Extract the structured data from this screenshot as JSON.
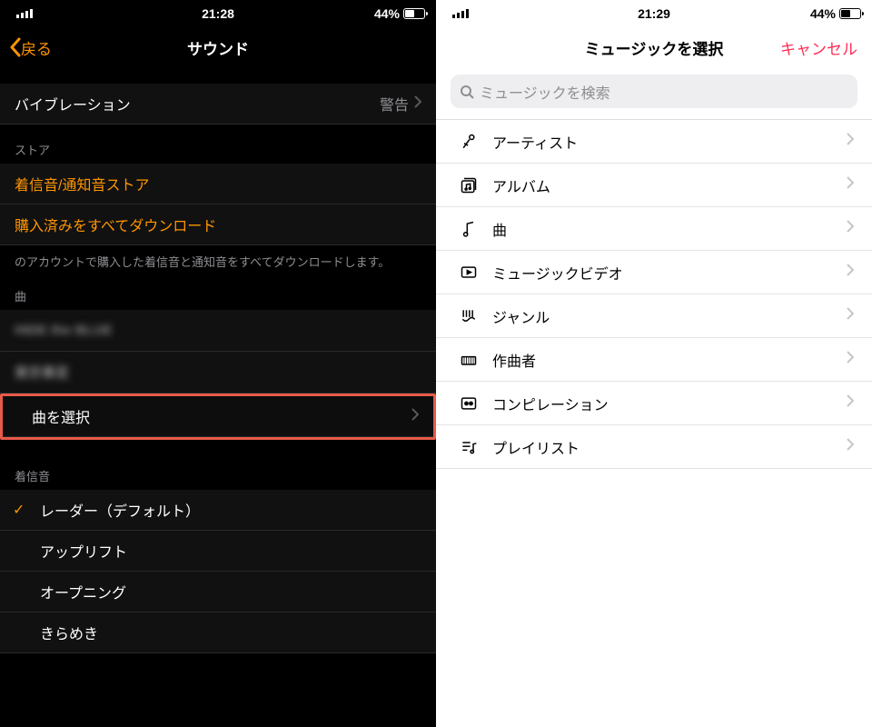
{
  "left": {
    "status": {
      "time": "21:28",
      "battery_text": "44%"
    },
    "nav": {
      "back_label": "戻る",
      "title": "サウンド"
    },
    "vibration": {
      "label": "バイブレーション",
      "value": "警告"
    },
    "store_header": "ストア",
    "store_link": "着信音/通知音ストア",
    "download_link": "購入済みをすべてダウンロード",
    "download_footnote": "のアカウントで購入した着信音と通知音をすべてダウンロードします。",
    "songs_header": "曲",
    "choose_song": "曲を選択",
    "ringtones_header": "着信音",
    "ringtones": [
      "レーダー（デフォルト）",
      "アップリフト",
      "オープニング",
      "きらめき"
    ]
  },
  "right": {
    "status": {
      "time": "21:29",
      "battery_text": "44%"
    },
    "nav": {
      "title": "ミュージックを選択",
      "cancel": "キャンセル"
    },
    "search_placeholder": "ミュージックを検索",
    "categories": [
      {
        "id": "artists",
        "label": "アーティスト"
      },
      {
        "id": "albums",
        "label": "アルバム"
      },
      {
        "id": "songs",
        "label": "曲"
      },
      {
        "id": "music-videos",
        "label": "ミュージックビデオ"
      },
      {
        "id": "genres",
        "label": "ジャンル"
      },
      {
        "id": "composers",
        "label": "作曲者"
      },
      {
        "id": "compilations",
        "label": "コンピレーション"
      },
      {
        "id": "playlists",
        "label": "プレイリスト"
      }
    ]
  }
}
